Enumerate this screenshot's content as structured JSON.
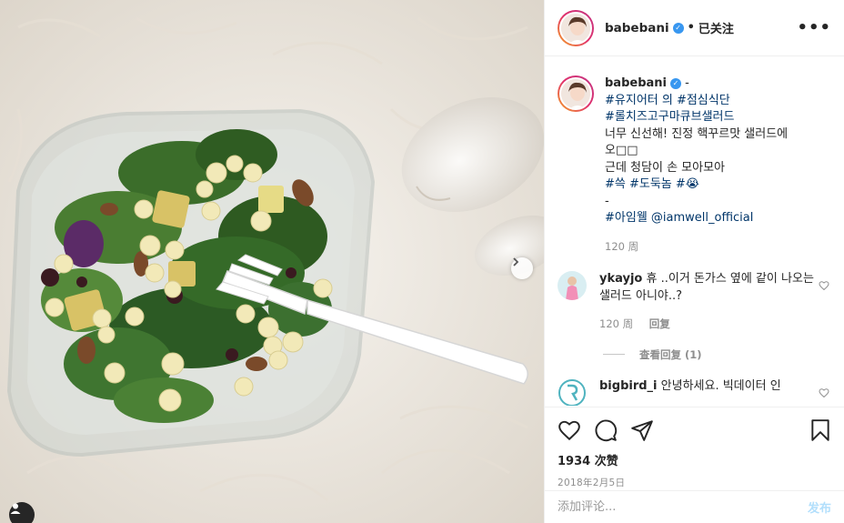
{
  "post": {
    "username": "babebani",
    "follow_label": "已关注",
    "dot": "•",
    "more_label": "•••"
  },
  "caption": {
    "username": "babebani",
    "suffix": " -",
    "lines": [
      {
        "text": "#유지어터 의 #점심식단",
        "type": "tag"
      },
      {
        "text": "#롤치즈고구마큐브샐러드",
        "type": "tag"
      },
      {
        "text": "너무 신선해! 진정 핵꾸르맛 샐러드에",
        "type": "text"
      },
      {
        "text": "오□□",
        "type": "text"
      },
      {
        "text": "근데 청담이 손 모아모아",
        "type": "text"
      },
      {
        "text": "#쓱 #도둑놈 #😭",
        "type": "tag"
      },
      {
        "text": "-",
        "type": "text"
      },
      {
        "text": "#아임웰 @iamwell_official",
        "type": "tag"
      }
    ],
    "time": "120 周"
  },
  "comments": [
    {
      "username": "ykayjo",
      "text": "휴 ..이거 돈가스 옆에 같이 나오는 샐러드 아니야..?",
      "time": "120 周",
      "reply_label": "回复",
      "view_replies": "查看回复 (1)"
    },
    {
      "username": "bigbird_i",
      "text": "안녕하세요. 빅데이터 인"
    }
  ],
  "actions": {
    "likes": "1934 次赞",
    "date": "2018年2月5日"
  },
  "composer": {
    "placeholder": "添加评论...",
    "post_label": "发布"
  },
  "icons": [
    "verified-badge-icon",
    "more-options-icon",
    "heart-icon",
    "comment-icon",
    "share-icon",
    "bookmark-icon",
    "chevron-right-icon"
  ],
  "colors": {
    "link": "#003569",
    "verified": "#3897f0",
    "post_disabled": "#b2dffc",
    "muted": "#8e8e8e"
  }
}
